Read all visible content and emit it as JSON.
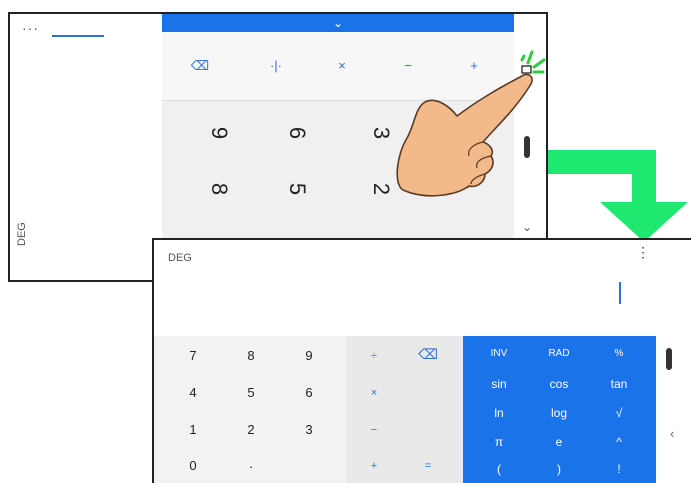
{
  "top_screen": {
    "display": {
      "mode_label": "DEG",
      "menu_dots": "···"
    },
    "handle": {
      "chevron": "⌄"
    },
    "operators": [
      "⌫",
      "·|·",
      "×",
      "−",
      "+"
    ],
    "numbers": [
      [
        "9",
        "6",
        "3"
      ],
      [
        "8",
        "5",
        "2",
        "."
      ]
    ],
    "side": {
      "chevron": "⌄"
    }
  },
  "bottom_screen": {
    "display": {
      "mode_label": "DEG",
      "menu": "⋮"
    },
    "numpad": [
      [
        "7",
        "8",
        "9"
      ],
      [
        "4",
        "5",
        "6"
      ],
      [
        "1",
        "2",
        "3"
      ],
      [
        "0",
        "."
      ]
    ],
    "operators": {
      "divide": "÷",
      "backspace": "⌫",
      "multiply": "×",
      "minus": "−",
      "plus": "+",
      "equals": "="
    },
    "scientific": [
      [
        "INV",
        "RAD",
        "%"
      ],
      [
        "sin",
        "cos",
        "tan"
      ],
      [
        "ln",
        "log",
        "√"
      ],
      [
        "π",
        "e",
        "^"
      ],
      [
        "(",
        ")",
        "!"
      ]
    ],
    "side": {
      "chevron": "‹"
    }
  },
  "colors": {
    "accent_blue": "#1a73e8",
    "arrow_green": "#1ee86f",
    "spark_green": "#2ecc40"
  }
}
